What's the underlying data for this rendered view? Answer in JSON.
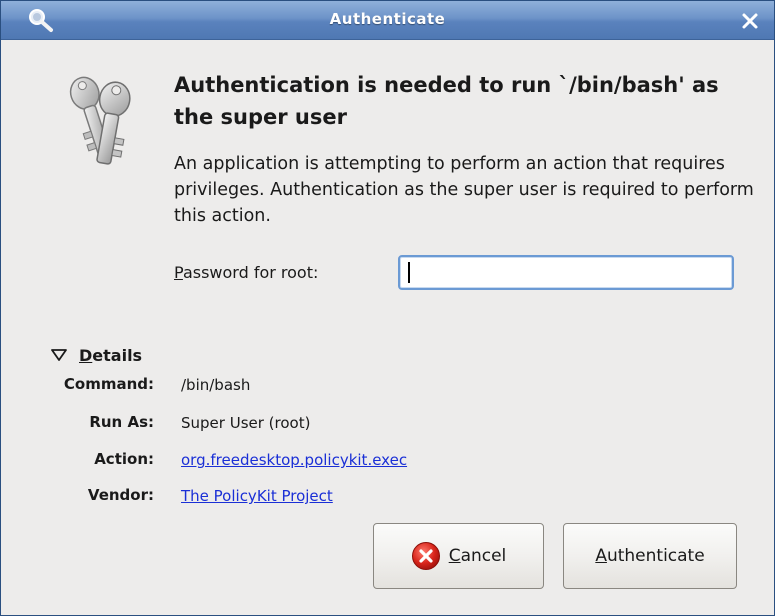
{
  "window": {
    "title": "Authenticate"
  },
  "dialog": {
    "heading": "Authentication is needed to run `/bin/bash' as the super user",
    "description": "An application is attempting to perform an action that requires privileges. Authentication as the super user is required to perform this action.",
    "password_label_mnemonic": "P",
    "password_label_rest": "assword for root:",
    "password_value": ""
  },
  "details": {
    "toggle_mnemonic": "D",
    "toggle_rest": "etails",
    "expanded": true,
    "rows": [
      {
        "label": "Command:",
        "value": "/bin/bash",
        "is_link": false
      },
      {
        "label": "Run As:",
        "value": "Super User (root)",
        "is_link": false
      },
      {
        "label": "Action:",
        "value": "org.freedesktop.policykit.exec",
        "is_link": true
      },
      {
        "label": "Vendor:",
        "value": "The PolicyKit Project",
        "is_link": true
      }
    ]
  },
  "buttons": {
    "cancel_mnemonic": "C",
    "cancel_rest": "ancel",
    "authenticate_mnemonic": "A",
    "authenticate_rest": "uthenticate"
  },
  "icons": {
    "title_icon": "key-search-icon",
    "close_icon": "close-icon",
    "dialog_icon": "keys-icon",
    "toggle_icon": "triangle-down-icon",
    "cancel_icon": "cancel-x-icon"
  },
  "colors": {
    "titlebar": "#5a82bd",
    "window_bg": "#edeceb",
    "link": "#1a2fd6",
    "input_focus": "#6b9ad4",
    "cancel_icon_red": "#d8251b"
  }
}
